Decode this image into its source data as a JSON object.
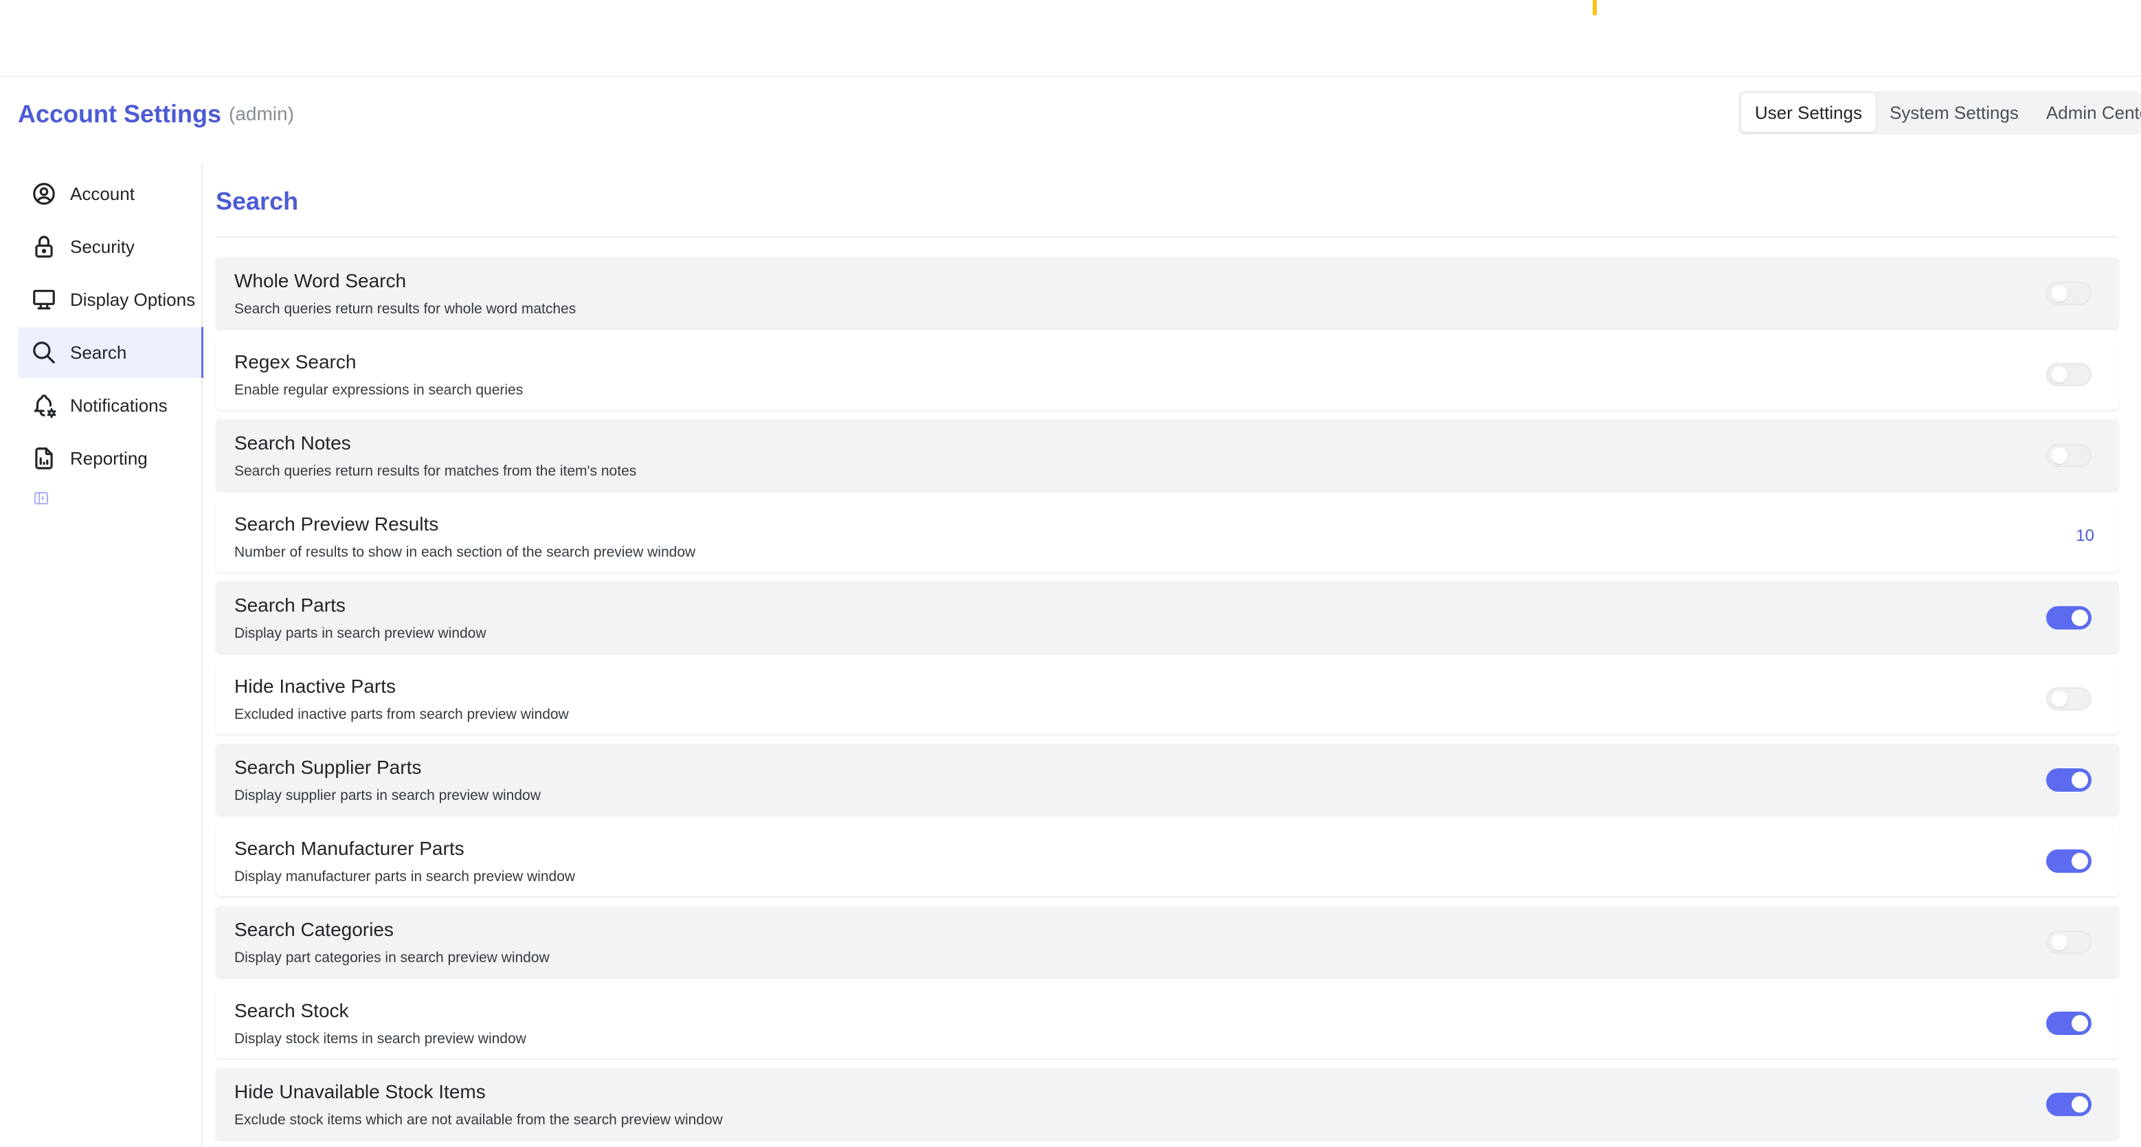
{
  "header": {
    "title": "Account Settings",
    "user": "(admin)"
  },
  "tabs": [
    {
      "label": "User Settings",
      "active": true
    },
    {
      "label": "System Settings",
      "active": false
    },
    {
      "label": "Admin Center",
      "active": false
    }
  ],
  "sidebar": {
    "items": [
      {
        "label": "Account",
        "icon": "user-circle-icon",
        "active": false
      },
      {
        "label": "Security",
        "icon": "lock-icon",
        "active": false
      },
      {
        "label": "Display Options",
        "icon": "monitor-icon",
        "active": false
      },
      {
        "label": "Search",
        "icon": "search-icon",
        "active": true
      },
      {
        "label": "Notifications",
        "icon": "bell-cog-icon",
        "active": false
      },
      {
        "label": "Reporting",
        "icon": "report-file-icon",
        "active": false
      }
    ],
    "collapse_icon": "sidebar-collapse-icon"
  },
  "section": {
    "title": "Search"
  },
  "settings": [
    {
      "name": "Whole Word Search",
      "description": "Search queries return results for whole word matches",
      "type": "toggle",
      "enabled": false
    },
    {
      "name": "Regex Search",
      "description": "Enable regular expressions in search queries",
      "type": "toggle",
      "enabled": false
    },
    {
      "name": "Search Notes",
      "description": "Search queries return results for matches from the item's notes",
      "type": "toggle",
      "enabled": false
    },
    {
      "name": "Search Preview Results",
      "description": "Number of results to show in each section of the search preview window",
      "type": "value",
      "value": "10"
    },
    {
      "name": "Search Parts",
      "description": "Display parts in search preview window",
      "type": "toggle",
      "enabled": true
    },
    {
      "name": "Hide Inactive Parts",
      "description": "Excluded inactive parts from search preview window",
      "type": "toggle",
      "enabled": false
    },
    {
      "name": "Search Supplier Parts",
      "description": "Display supplier parts in search preview window",
      "type": "toggle",
      "enabled": true
    },
    {
      "name": "Search Manufacturer Parts",
      "description": "Display manufacturer parts in search preview window",
      "type": "toggle",
      "enabled": true
    },
    {
      "name": "Search Categories",
      "description": "Display part categories in search preview window",
      "type": "toggle",
      "enabled": false
    },
    {
      "name": "Search Stock",
      "description": "Display stock items in search preview window",
      "type": "toggle",
      "enabled": true
    },
    {
      "name": "Hide Unavailable Stock Items",
      "description": "Exclude stock items which are not available from the search preview window",
      "type": "toggle",
      "enabled": true
    }
  ],
  "colors": {
    "accent": "#5c6bf0",
    "title": "#4c5bd4",
    "row_shaded": "#f1f3f5"
  }
}
